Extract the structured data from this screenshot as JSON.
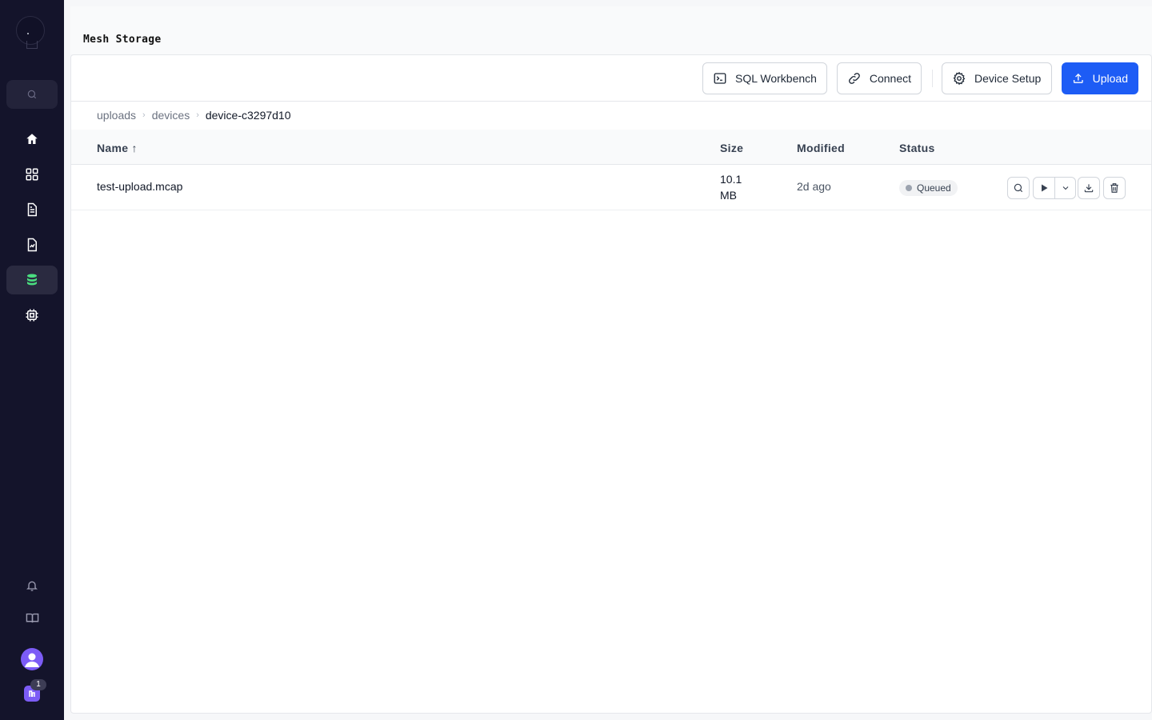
{
  "page": {
    "title": "Mesh Storage"
  },
  "sidebar": {
    "items": [
      {
        "name": "home",
        "icon": "home-icon"
      },
      {
        "name": "apps",
        "icon": "grid-icon"
      },
      {
        "name": "documents",
        "icon": "document-icon"
      },
      {
        "name": "reports",
        "icon": "chart-file-icon"
      },
      {
        "name": "storage",
        "icon": "database-icon",
        "active": true
      },
      {
        "name": "devices",
        "icon": "chip-icon"
      }
    ],
    "bottom": [
      {
        "name": "notifications",
        "icon": "bell-icon"
      },
      {
        "name": "docs",
        "icon": "book-icon"
      }
    ],
    "workspace_badge_count": "1",
    "accent": "#7c5cf6"
  },
  "toolbar": {
    "sql_label": "SQL Workbench",
    "connect_label": "Connect",
    "device_setup_label": "Device Setup",
    "upload_label": "Upload",
    "primary_color": "#1d5cf5"
  },
  "breadcrumb": [
    "uploads",
    "devices",
    "device-c3297d10"
  ],
  "table": {
    "columns": {
      "name": "Name ↑",
      "size": "Size",
      "modified": "Modified",
      "status": "Status"
    },
    "rows": [
      {
        "name": "test-upload.mcap",
        "size": "10.1 MB",
        "modified": "2d ago",
        "status": "Queued"
      }
    ]
  }
}
